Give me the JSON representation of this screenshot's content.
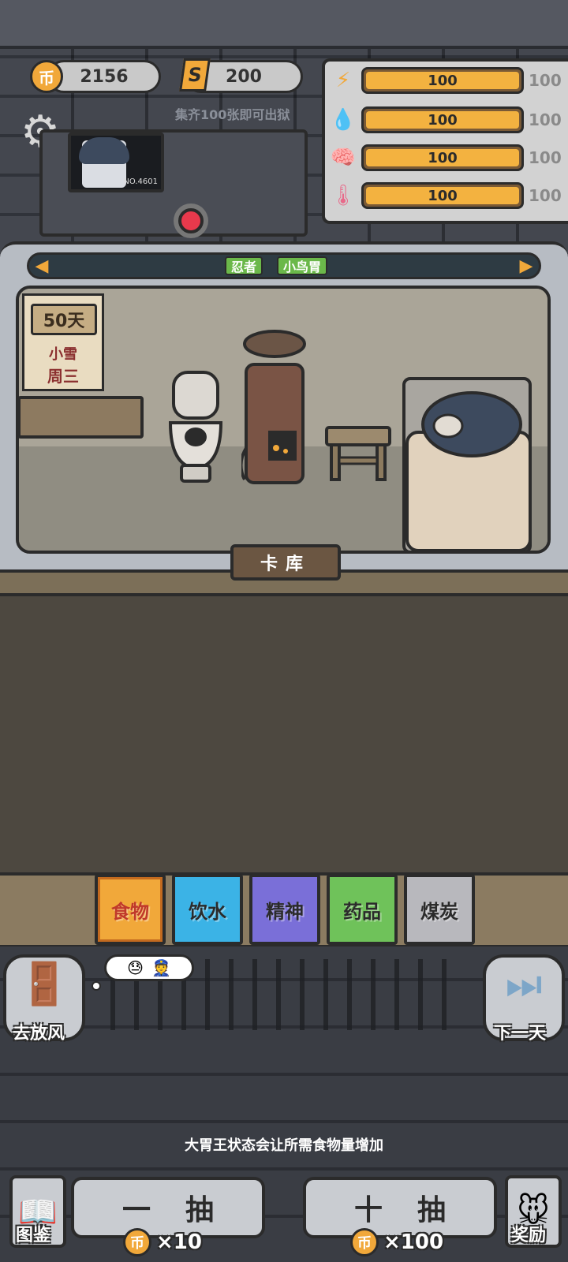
{
  "currency": {
    "coins": "2156",
    "coin_icon": "币",
    "tickets": "200",
    "ticket_icon": "S",
    "hint": "集齐100张即可出狱"
  },
  "stats": [
    {
      "icon": "lightning-icon",
      "glyph": "⚡",
      "value": "100",
      "max": "100",
      "color": "#f1a83a"
    },
    {
      "icon": "water-drop-icon",
      "glyph": "💧",
      "value": "100",
      "max": "100",
      "color": "#5ab0e8"
    },
    {
      "icon": "brain-icon",
      "glyph": "🧠",
      "value": "100",
      "max": "100",
      "color": "#8a7be0"
    },
    {
      "icon": "thermometer-icon",
      "glyph": "🌡",
      "value": "100",
      "max": "100",
      "color": "#e86a8a"
    }
  ],
  "monitor": {
    "id": "NO.4601"
  },
  "character": {
    "tags": [
      "忍者",
      "小鸟胃"
    ]
  },
  "calendar": {
    "day": "50天",
    "weather": "小雪",
    "weekday": "周三"
  },
  "library_label": "卡库",
  "categories": [
    {
      "label": "食物",
      "color": "#f1a83a",
      "selected": true
    },
    {
      "label": "饮水",
      "color": "#3bb3e6",
      "selected": false
    },
    {
      "label": "精神",
      "color": "#7a6fd8",
      "selected": false
    },
    {
      "label": "药品",
      "color": "#6fc25a",
      "selected": false
    },
    {
      "label": "煤炭",
      "color": "#b8b8bd",
      "selected": false
    }
  ],
  "actions": {
    "go_out": "去放风",
    "next_day": "下一天",
    "tip": "大胃王状态会让所需食物量增加",
    "draw_one": "一抽",
    "draw_ten": "十抽",
    "draw_one_cost": "×10",
    "draw_ten_cost": "×100",
    "codex": "图鉴",
    "reward": "奖励"
  }
}
